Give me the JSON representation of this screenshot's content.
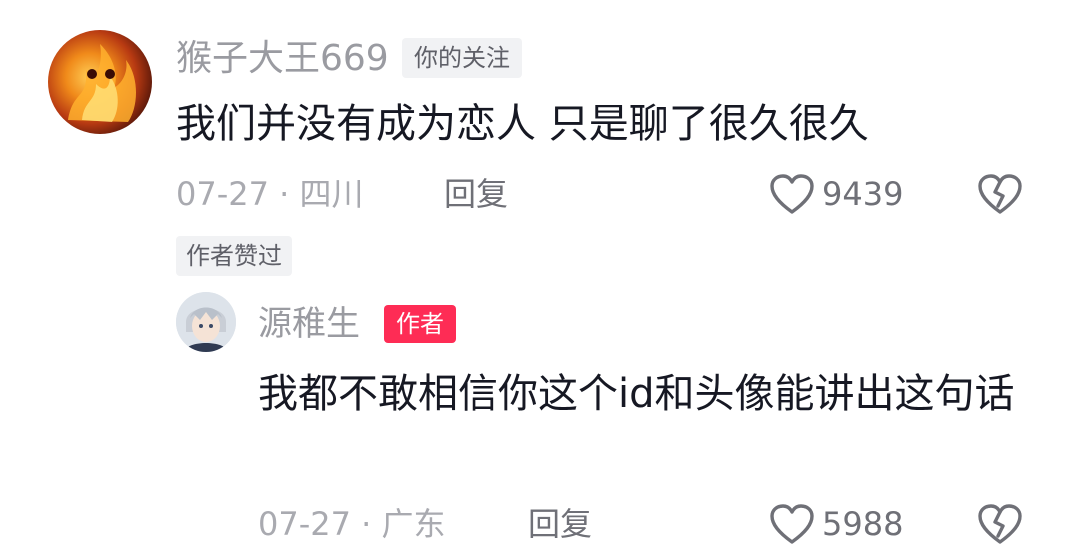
{
  "comment": {
    "username": "猴子大王669",
    "follow_tag": "你的关注",
    "text": "我们并没有成为恋人 只是聊了很久很久",
    "meta": "07-27 · 四川",
    "reply_label": "回复",
    "like_count": "9439",
    "author_liked_tag": "作者赞过"
  },
  "reply": {
    "username": "源稚生",
    "author_tag": "作者",
    "text": "我都不敢相信你这个id和头像能讲出这句话",
    "meta": "07-27 · 广东",
    "reply_label": "回复",
    "like_count": "5988"
  },
  "colors": {
    "author_tag_bg": "#fe2c55",
    "muted_text": "#a9aab0",
    "main_text": "#161823"
  },
  "icons": {
    "like": "heart-outline-icon",
    "dislike": "broken-heart-icon"
  }
}
